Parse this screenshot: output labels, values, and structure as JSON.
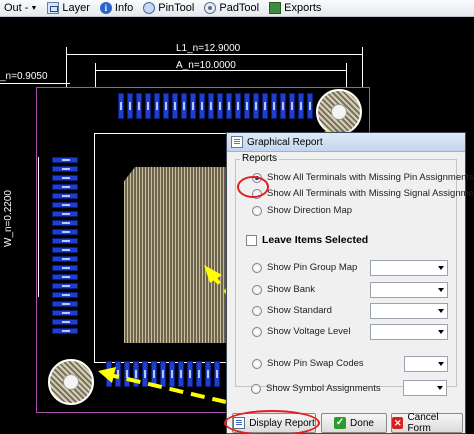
{
  "menubar": {
    "items": [
      {
        "label": "Out -",
        "icon": "none",
        "has_arrow": true
      },
      {
        "label": "Layer",
        "icon": "layer-icon"
      },
      {
        "label": "Info",
        "icon": "info-icon"
      },
      {
        "label": "PinTool",
        "icon": "pin-tool-icon"
      },
      {
        "label": "PadTool",
        "icon": "pad-tool-icon"
      },
      {
        "label": "Exports",
        "icon": "exports-icon"
      }
    ]
  },
  "canvas": {
    "dim_l1": "L1_n=12.9000",
    "dim_a": "A_n=10.0000",
    "dim_left": "_n=0.9050",
    "dim_w": "W_n=0.2200",
    "colors": {
      "background": "#000000",
      "pad": "#1f3fd2",
      "outline": "#b04fb0",
      "annotation": "#ffff00"
    }
  },
  "dialog": {
    "title": "Graphical Report",
    "reports_group_label": "Reports",
    "reports_options": [
      {
        "label": "Show All Terminals with Missing Pin Assignments",
        "checked": true
      },
      {
        "label": "Show All Terminals with Missing Signal  Assignments",
        "checked": false
      },
      {
        "label": "Show Direction Map",
        "checked": false
      }
    ],
    "leave_items_label": "Leave Items Selected",
    "map_options": [
      {
        "label": "Show Pin Group Map",
        "combo_value": ""
      },
      {
        "label": "Show Bank",
        "combo_value": ""
      },
      {
        "label": "Show Standard",
        "combo_value": ""
      },
      {
        "label": "Show Voltage Level",
        "combo_value": ""
      }
    ],
    "extra_options": [
      {
        "label": "Show Pin Swap Codes",
        "combo_value": ""
      },
      {
        "label": "Show Symbol  Assignments",
        "combo_value": ""
      }
    ],
    "buttons": {
      "display_report": "Display Report",
      "done": "Done",
      "cancel_form": "Cancel Form"
    }
  }
}
